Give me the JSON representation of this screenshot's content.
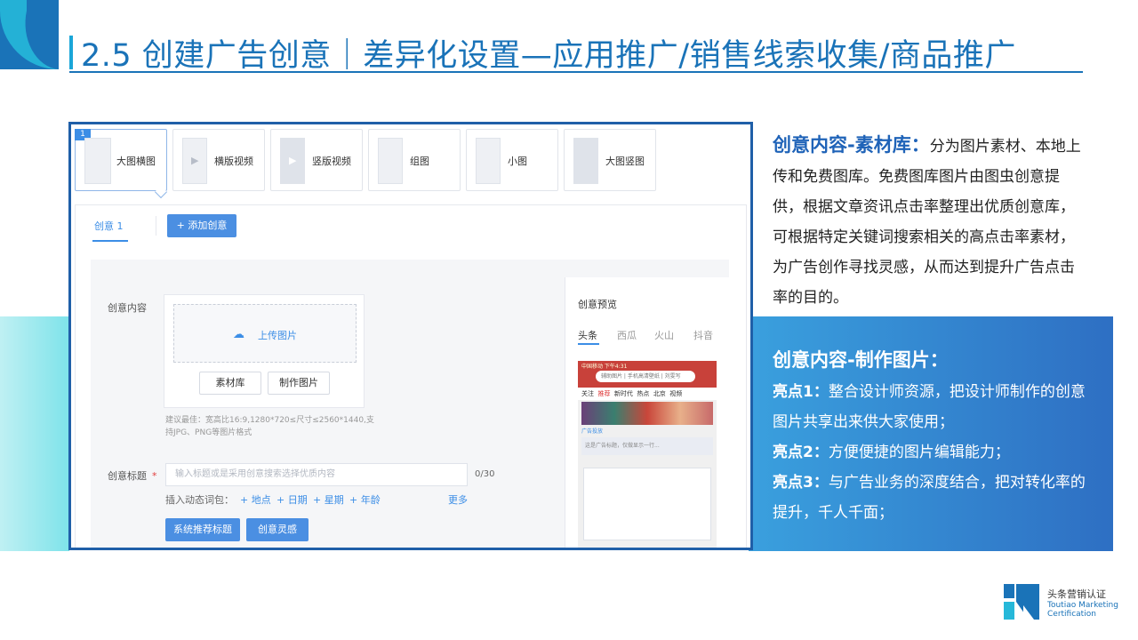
{
  "slide": {
    "title": "2.5 创建广告创意｜差异化设置—应用推广/销售线索收集/商品推广",
    "colors": {
      "accent": "#1a73b8",
      "band": "#2e6fc3",
      "teal": "#7ee3ea"
    }
  },
  "screenshot": {
    "format_cards": [
      {
        "label": "大图横图",
        "badge": "1",
        "active": true
      },
      {
        "label": "横版视频"
      },
      {
        "label": "竖版视频"
      },
      {
        "label": "组图"
      },
      {
        "label": "小图"
      },
      {
        "label": "大图竖图"
      }
    ],
    "tab_label": "创意 1",
    "add_button": "+ 添加创意",
    "content_label": "创意内容",
    "upload_label": "上传图片",
    "upload_icon": "cloud-upload-icon",
    "library_button": "素材库",
    "make_image_button": "制作图片",
    "hint": "建议最佳：宽高比16:9,1280*720≤尺寸≤2560*1440,支持JPG、PNG等图片格式",
    "title_label": "创意标题",
    "title_required": "*",
    "title_placeholder": "输入标题或是采用创意搜索选择优质内容",
    "title_counter": "0/30",
    "dynamic_label": "插入动态词包：",
    "dynamic_words": [
      "+ 地点",
      "+ 日期",
      "+ 星期",
      "+ 年龄"
    ],
    "more_link": "更多",
    "recommend_button": "系统推荐标题",
    "inspiration_button": "创意灵感",
    "preview": {
      "title": "创意预览",
      "tabs": [
        "头条",
        "西瓜",
        "火山",
        "抖音"
      ],
      "phone_status": "中国移动   下午4:31",
      "phone_search": "辅助图片 | 手机高清壁纸 | 刘雯写",
      "phone_nav": [
        "关注",
        "推荐",
        "新时代",
        "热点",
        "北京",
        "视频"
      ],
      "phone_ad": "广告投放",
      "phone_desc": "这是广告标题，仅做显示一行..."
    }
  },
  "right_text": {
    "p1_heading": "创意内容-素材库：",
    "p1_body": "分为图片素材、本地上传和免费图库。免费图库图片由图虫创意提供，根据文章资讯点击率整理出优质创意库，可根据特定关键词搜索相关的高点击率素材，为广告创作寻找灵感，从而达到提升广告点击率的目的。",
    "p2_heading": "创意内容-制作图片：",
    "points": [
      {
        "label": "亮点1：",
        "text": "整合设计师资源，把设计师制作的创意图片共享出来供大家使用；"
      },
      {
        "label": "亮点2：",
        "text": "方便便捷的图片编辑能力；"
      },
      {
        "label": "亮点3：",
        "text": "与广告业务的深度结合，把对转化率的提升，千人千面；"
      }
    ]
  },
  "logo": {
    "cn": "头条营销认证",
    "en_line1": "Toutiao Marketing",
    "en_line2": "Certification"
  }
}
